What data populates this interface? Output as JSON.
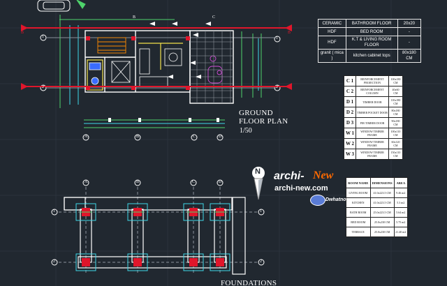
{
  "drawing": {
    "ground_title_line1": "GROUND",
    "ground_title_line2": "FLOOR PLAN",
    "ground_scale": "1/50",
    "foundations_title": "FOUNDATIONS",
    "north_label": "N"
  },
  "finishes": [
    [
      "CERAMIC",
      "BATHROOM FLOOR",
      "20x20"
    ],
    [
      "HDF",
      "BED ROOM",
      "-"
    ],
    [
      "HDF",
      "K.T & LIVING ROOM FLOOR",
      "-"
    ],
    [
      "granit ( mica )",
      "kitchen cabinet tops",
      "80x180 CM"
    ]
  ],
  "schedule": [
    [
      "C 1",
      "REINFORCEMENT PROJECTION",
      "100x180 CM"
    ],
    [
      "C 2",
      "REINFORCEMENT COLUMN",
      "40x60 CM"
    ],
    [
      "D 1",
      "TIMBER DOOR",
      "110x180 CM"
    ],
    [
      "D 2",
      "TIMBER POCKET DOOR",
      "80x180 CM"
    ],
    [
      "D 3",
      "PIR TIMBER DOOR",
      "90x180 CM"
    ],
    [
      "W 1",
      "WINDOW TIMBER FRAME",
      "100x110 CM"
    ],
    [
      "W 2",
      "WINDOW TIMBER FRAME",
      "60x120 CM"
    ],
    [
      "W 3",
      "WINDOW TIMBER FRAME",
      "150x110 CM"
    ]
  ],
  "rooms": {
    "headers": [
      "ROOM NAME",
      "DIMENSIONS",
      "AREA"
    ],
    "rows": [
      [
        "LIVING ROOM",
        "41.0x223.5 CM",
        "9.46 m2"
      ],
      [
        "KITCHEN",
        "41.0x223.5 CM",
        "5.3 m2"
      ],
      [
        "BATH ROOM",
        "25.0x223.5 CM",
        "5.64 m2"
      ],
      [
        "BED ROOM",
        "25.0x230 CM",
        "5.75 m2"
      ],
      [
        "TERRACE",
        "25.0x230 CM",
        "21.40 m2"
      ]
    ]
  },
  "grid": {
    "cols": [
      "A",
      "B",
      "C",
      "D"
    ],
    "rows": [
      "1",
      "2"
    ],
    "cols_top": [
      "B",
      "C"
    ],
    "row_side": "B"
  },
  "watermark": {
    "brand": "archi-",
    "brand_accent": "New",
    "url": "archi-new.com",
    "brand2": "Dwhatnow"
  },
  "colors": {
    "background": "#212830",
    "red_line": "#e0162b",
    "green": "#4ed36b",
    "cyan": "#3fd7e8",
    "yellow": "#f3e24a",
    "white": "#ffffff",
    "blue_water": "#3a6cff",
    "orange": "#ff8a00",
    "magenta": "#d24bd8"
  }
}
